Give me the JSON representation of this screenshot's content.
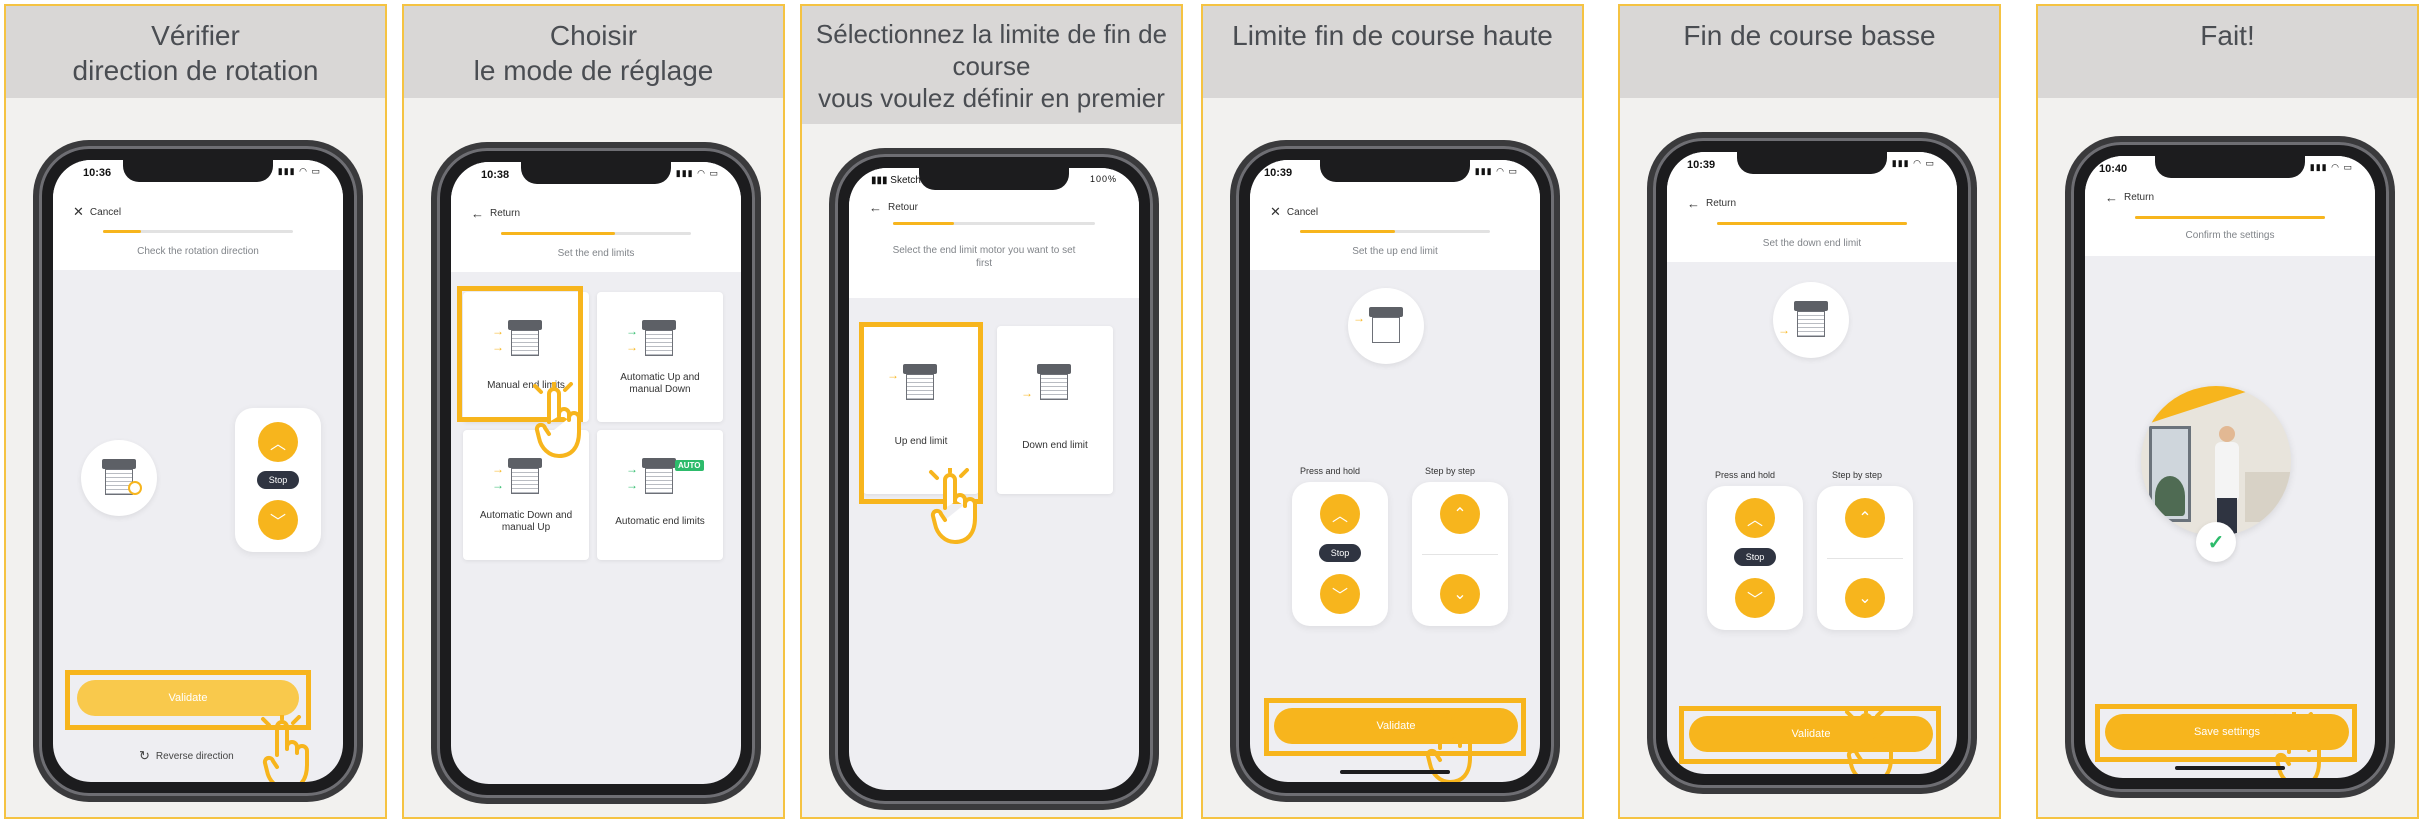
{
  "colors": {
    "accent": "#F7B51D",
    "panel_border": "#F5C342",
    "header_bg": "#d9d7d6",
    "stop_pill": "#2f3441",
    "auto_badge": "#2dbb6b"
  },
  "panels": [
    {
      "header_lines": [
        "Vérifier",
        "direction de rotation"
      ],
      "phone": {
        "time": "10:36",
        "nav_label": "Cancel",
        "nav_icon": "close-icon",
        "step_title": "Check the rotation direction",
        "progress": 0.2,
        "stop_label": "Stop",
        "primary_button": "Validate",
        "secondary_button": "Reverse direction"
      }
    },
    {
      "header_lines": [
        "Choisir",
        "le mode de réglage"
      ],
      "phone": {
        "time": "10:38",
        "nav_label": "Return",
        "nav_icon": "back-arrow-icon",
        "step_title": "Set the end limits",
        "progress": 0.6,
        "modes": [
          "Manual end limits",
          "Automatic Up and manual Down",
          "Automatic Down and manual Up",
          "Automatic end limits"
        ],
        "auto_badge": "AUTO"
      }
    },
    {
      "header_lines": [
        "Sélectionnez la limite de fin de",
        "course",
        "vous voulez définir en premier"
      ],
      "phone": {
        "carrier": "Sketch",
        "battery": "100%",
        "nav_label": "Retour",
        "nav_icon": "back-arrow-icon",
        "step_title": "Select the end limit motor you want to set first",
        "progress": 0.3,
        "options": [
          "Up end limit",
          "Down end limit"
        ]
      }
    },
    {
      "header_lines": [
        "Limite fin de course haute"
      ],
      "phone": {
        "time": "10:39",
        "nav_label": "Cancel",
        "nav_icon": "close-icon",
        "step_title": "Set the up end limit",
        "progress": 0.5,
        "press_hold_label": "Press and hold",
        "step_by_step_label": "Step by step",
        "stop_label": "Stop",
        "primary_button": "Validate"
      }
    },
    {
      "header_lines": [
        "Fin de course basse"
      ],
      "phone": {
        "time": "10:39",
        "nav_label": "Return",
        "nav_icon": "back-arrow-icon",
        "step_title": "Set the down end limit",
        "progress": 0.8,
        "press_hold_label": "Press and hold",
        "step_by_step_label": "Step by step",
        "stop_label": "Stop",
        "primary_button": "Validate"
      }
    },
    {
      "header_lines": [
        "Fait!"
      ],
      "phone": {
        "time": "10:40",
        "nav_label": "Return",
        "nav_icon": "back-arrow-icon",
        "step_title": "Confirm the settings",
        "progress": 1.0,
        "primary_button": "Save settings"
      }
    }
  ]
}
